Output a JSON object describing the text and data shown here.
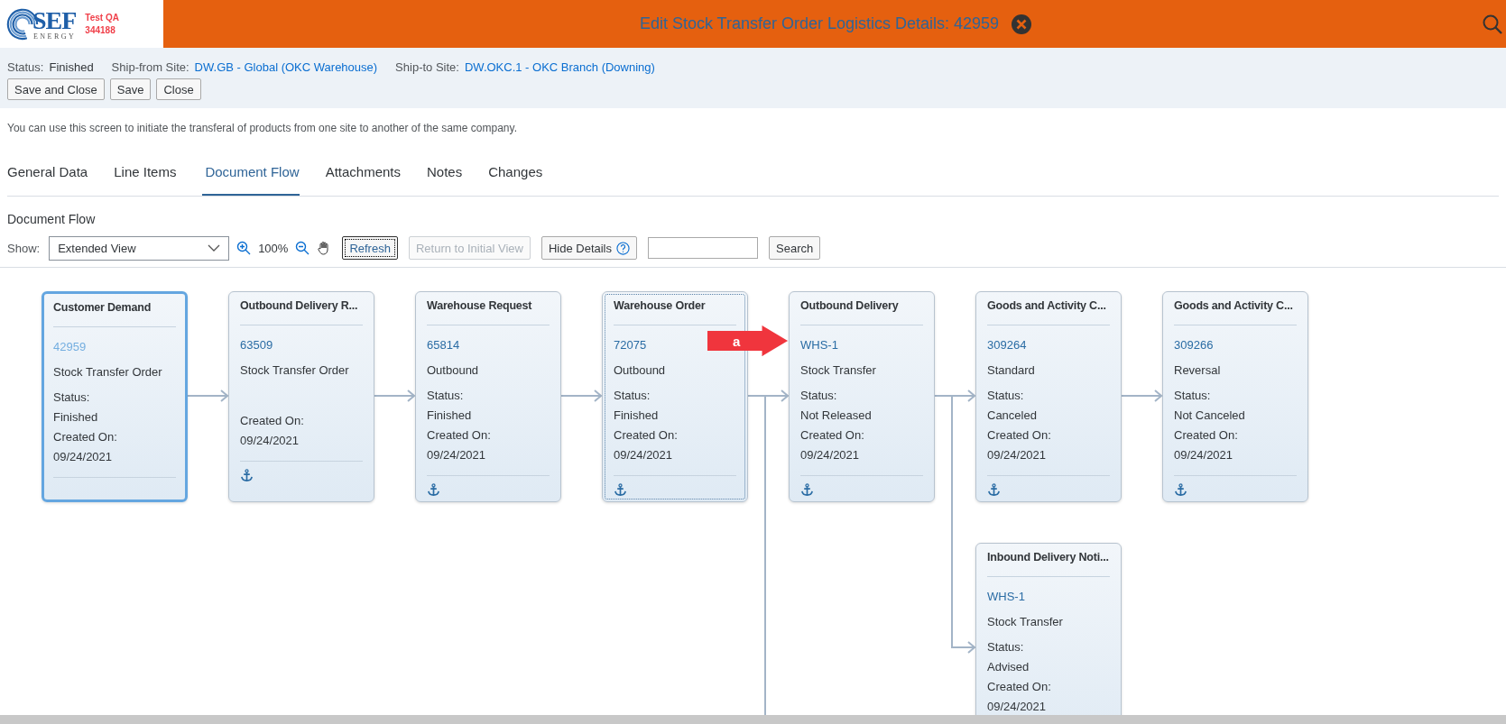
{
  "header": {
    "logo": {
      "name": "SEF",
      "sub": "ENERGY"
    },
    "environment": [
      "Test QA",
      "344188"
    ],
    "title": "Edit Stock Transfer Order Logistics Details: 42959"
  },
  "info": {
    "fields": [
      {
        "label": "Status:",
        "value": "Finished",
        "kind": "text"
      },
      {
        "label": "Ship-from Site:",
        "value": "DW.GB - Global (OKC Warehouse)",
        "kind": "link"
      },
      {
        "label": "Ship-to Site:",
        "value": "DW.OKC.1 - OKC Branch (Downing)",
        "kind": "link"
      }
    ],
    "buttons": [
      "Save and Close",
      "Save",
      "Close"
    ]
  },
  "description": "You can use this screen to initiate the transferal of products from one site to another of the same company.",
  "tabs": [
    {
      "label": "General Data",
      "selected": false
    },
    {
      "label": "Line Items",
      "selected": false
    },
    {
      "label": "Document Flow",
      "selected": true
    },
    {
      "label": "Attachments",
      "selected": false
    },
    {
      "label": "Notes",
      "selected": false
    },
    {
      "label": "Changes",
      "selected": false
    }
  ],
  "section_title": "Document Flow",
  "toolbar": {
    "show_label": "Show:",
    "view": "Extended View",
    "zoom": "100%",
    "buttons": [
      {
        "label": "Refresh",
        "disabled": false,
        "focused": true,
        "help": false
      },
      {
        "label": "Return to Initial View",
        "disabled": true,
        "focused": false,
        "help": false
      },
      {
        "label": "Hide Details",
        "disabled": false,
        "focused": false,
        "help": true
      }
    ],
    "search_button": "Search"
  },
  "flow": {
    "title": "Customer Demand",
    "number": "42959",
    "type": "Stock Transfer Order",
    "status_label": "Status:",
    "status": "Finished",
    "created_label": "Created On:",
    "created_on": "09/24/2021",
    "anchor": false,
    "selected": true,
    "focused": false,
    "children": [
      {
        "title": "Outbound Delivery R...",
        "number": "63509",
        "type": "Stock Transfer Order",
        "created_label": "Created On:",
        "created_on": "09/24/2021",
        "anchor": true,
        "selected": false,
        "focused": false,
        "children": [
          {
            "title": "Warehouse Request",
            "number": "65814",
            "type": "Outbound",
            "status_label": "Status:",
            "status": "Finished",
            "created_label": "Created On:",
            "created_on": "09/24/2021",
            "anchor": true,
            "selected": false,
            "focused": false,
            "children": [
              {
                "title": "Warehouse Order",
                "number": "72075",
                "type": "Outbound",
                "status_label": "Status:",
                "status": "Finished",
                "created_label": "Created On:",
                "created_on": "09/24/2021",
                "anchor": true,
                "selected": false,
                "focused": true,
                "continues_below": true,
                "children": [
                  {
                    "title": "Outbound Delivery",
                    "number": "WHS-1",
                    "type": "Stock Transfer",
                    "status_label": "Status:",
                    "status": "Not Released",
                    "created_label": "Created On:",
                    "created_on": "09/24/2021",
                    "anchor": true,
                    "selected": false,
                    "focused": false,
                    "children": [
                      {
                        "title": "Goods and Activity C...",
                        "number": "309264",
                        "type": "Standard",
                        "status_label": "Status:",
                        "status": "Canceled",
                        "created_label": "Created On:",
                        "created_on": "09/24/2021",
                        "anchor": true,
                        "selected": false,
                        "focused": false,
                        "children": [
                          {
                            "title": "Goods and Activity C...",
                            "number": "309266",
                            "type": "Reversal",
                            "status_label": "Status:",
                            "status": "Not Canceled",
                            "created_label": "Created On:",
                            "created_on": "09/24/2021",
                            "anchor": true,
                            "selected": false,
                            "focused": false
                          }
                        ]
                      },
                      {
                        "title": "Inbound Delivery Noti...",
                        "number": "WHS-1",
                        "type": "Stock Transfer",
                        "status_label": "Status:",
                        "status": "Advised",
                        "created_label": "Created On:",
                        "created_on": "09/24/2021",
                        "selected": false,
                        "focused": false
                      }
                    ]
                  }
                ]
              }
            ]
          }
        ]
      }
    ]
  },
  "callout": {
    "label": "a"
  }
}
